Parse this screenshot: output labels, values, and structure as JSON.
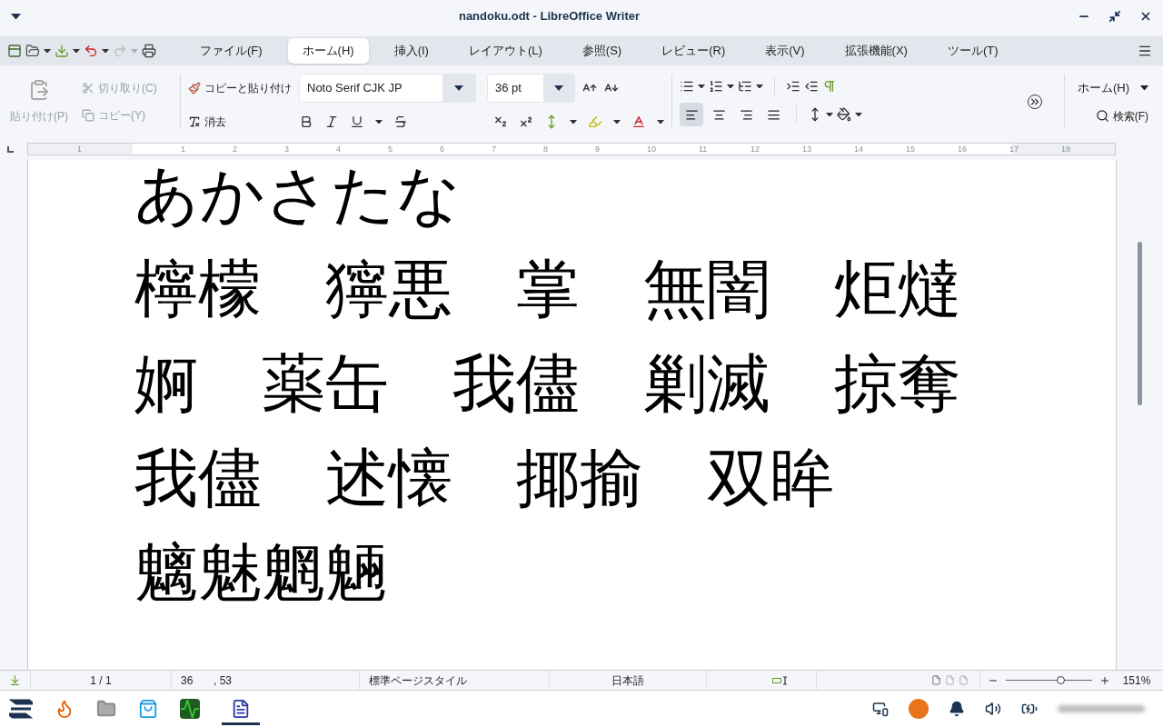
{
  "window": {
    "title": "nandoku.odt - LibreOffice Writer"
  },
  "tabs": [
    {
      "label": "ファイル(F)",
      "selected": false
    },
    {
      "label": "ホーム(H)",
      "selected": true
    },
    {
      "label": "挿入(I)",
      "selected": false
    },
    {
      "label": "レイアウト(L)",
      "selected": false
    },
    {
      "label": "参照(S)",
      "selected": false
    },
    {
      "label": "レビュー(R)",
      "selected": false
    },
    {
      "label": "表示(V)",
      "selected": false
    },
    {
      "label": "拡張機能(X)",
      "selected": false
    },
    {
      "label": "ツール(T)",
      "selected": false
    }
  ],
  "toolbar": {
    "paste": {
      "label": "貼り付け(P)",
      "disabled": true
    },
    "cut": {
      "label": "切り取り(C)",
      "disabled": true
    },
    "copy": {
      "label": "コピー(Y)",
      "disabled": true
    },
    "clone": {
      "label": "コピーと貼り付け",
      "disabled": false
    },
    "clear": {
      "label": "消去",
      "disabled": false
    },
    "font_name": "Noto Serif CJK JP",
    "font_size": "36 pt",
    "align": [
      {
        "kind": "left",
        "selected": true
      },
      {
        "kind": "center",
        "selected": false
      },
      {
        "kind": "right",
        "selected": false
      },
      {
        "kind": "justify",
        "selected": false
      }
    ],
    "tab_dropdown": "ホーム(H)",
    "search": "検索(F)"
  },
  "ruler": {
    "left_label": "1",
    "labels": [
      "1",
      "2",
      "3",
      "4",
      "5",
      "6",
      "7",
      "8",
      "9",
      "10",
      "11",
      "12",
      "13",
      "14",
      "15",
      "16",
      "17",
      "18"
    ]
  },
  "document": {
    "lines": [
      "あかさたな",
      "檸檬　獰悪　掌　無闇　炬燵",
      "婀　薬缶　我儘　剿滅　掠奪",
      "我儘　述懐　揶揄　双眸",
      "魑魅魍魎"
    ]
  },
  "status_bar": {
    "page": "1 / 1",
    "words": "36",
    "chars": ", 53",
    "page_style": "標準ページスタイル",
    "language": "日本語",
    "zoom_slider": {
      "level": 0.63
    },
    "zoom": "151%"
  }
}
